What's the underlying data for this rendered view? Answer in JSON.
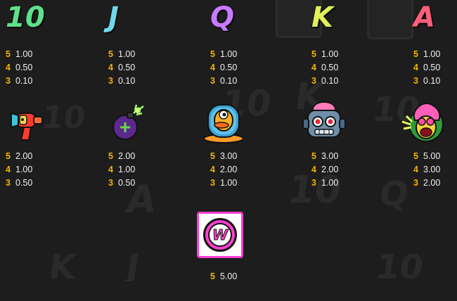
{
  "symbols": [
    {
      "id": "ten",
      "name": "10",
      "color": "#5fe08a",
      "pays": [
        {
          "count": "5",
          "value": "1.00"
        },
        {
          "count": "4",
          "value": "0.50"
        },
        {
          "count": "3",
          "value": "0.10"
        }
      ]
    },
    {
      "id": "jack",
      "name": "J",
      "color": "#6fd6e8",
      "pays": [
        {
          "count": "5",
          "value": "1.00"
        },
        {
          "count": "4",
          "value": "0.50"
        },
        {
          "count": "3",
          "value": "0.10"
        }
      ]
    },
    {
      "id": "queen",
      "name": "Q",
      "color": "#c77bff",
      "pays": [
        {
          "count": "5",
          "value": "1.00"
        },
        {
          "count": "4",
          "value": "0.50"
        },
        {
          "count": "3",
          "value": "0.10"
        }
      ]
    },
    {
      "id": "king",
      "name": "K",
      "color": "#dff05a",
      "pays": [
        {
          "count": "5",
          "value": "1.00"
        },
        {
          "count": "4",
          "value": "0.50"
        },
        {
          "count": "3",
          "value": "0.10"
        }
      ]
    },
    {
      "id": "ace",
      "name": "A",
      "color": "#ff5f7a",
      "pays": [
        {
          "count": "5",
          "value": "1.00"
        },
        {
          "count": "4",
          "value": "0.50"
        },
        {
          "count": "3",
          "value": "0.10"
        }
      ]
    },
    {
      "id": "raygun",
      "icon": "ray-gun-icon",
      "pays": [
        {
          "count": "5",
          "value": "2.00"
        },
        {
          "count": "4",
          "value": "1.00"
        },
        {
          "count": "3",
          "value": "0.50"
        }
      ]
    },
    {
      "id": "bomb",
      "icon": "bomb-icon",
      "pays": [
        {
          "count": "5",
          "value": "2.00"
        },
        {
          "count": "4",
          "value": "1.00"
        },
        {
          "count": "3",
          "value": "0.50"
        }
      ]
    },
    {
      "id": "duck",
      "icon": "alien-duck-icon",
      "pays": [
        {
          "count": "5",
          "value": "3.00"
        },
        {
          "count": "4",
          "value": "2.00"
        },
        {
          "count": "3",
          "value": "1.00"
        }
      ]
    },
    {
      "id": "robot",
      "icon": "robot-head-icon",
      "pays": [
        {
          "count": "5",
          "value": "3.00"
        },
        {
          "count": "4",
          "value": "2.00"
        },
        {
          "count": "3",
          "value": "1.00"
        }
      ]
    },
    {
      "id": "monster",
      "icon": "pink-monster-icon",
      "pays": [
        {
          "count": "5",
          "value": "5.00"
        },
        {
          "count": "4",
          "value": "3.00"
        },
        {
          "count": "3",
          "value": "2.00"
        }
      ]
    },
    {
      "id": "wild",
      "name": "W",
      "icon": "wild-w-icon",
      "pays": [
        {
          "count": "5",
          "value": "5.00"
        }
      ]
    }
  ],
  "colors": {
    "background": "#1d1d1d",
    "count": "#f4b400",
    "value": "#f1f1f1",
    "wild_frame": "#ff3fd2"
  }
}
